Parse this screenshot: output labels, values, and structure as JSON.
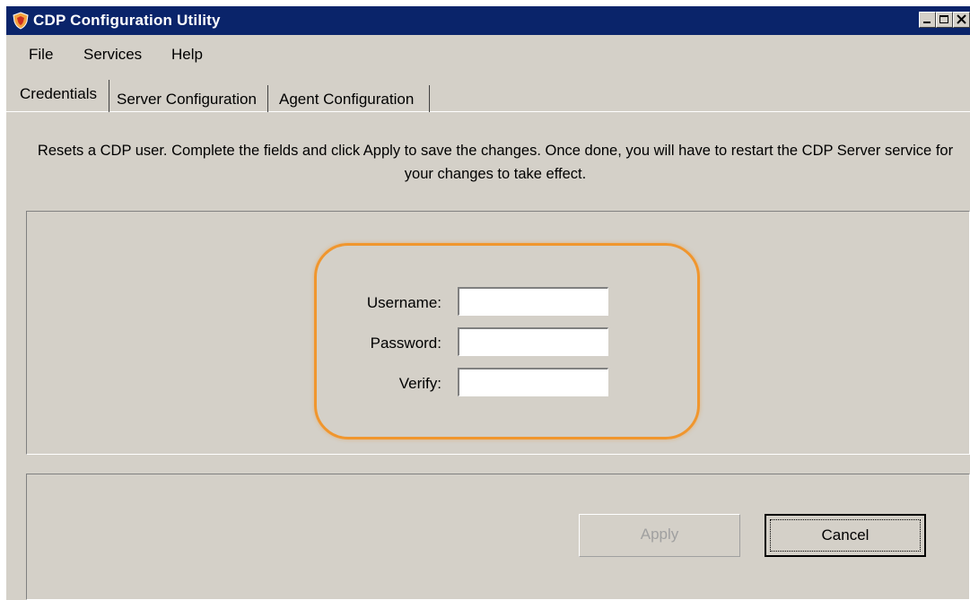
{
  "window": {
    "title": "CDP Configuration Utility",
    "icon": "shield-icon",
    "controls": [
      "minimize-icon",
      "maximize-icon",
      "close-icon"
    ]
  },
  "menu": {
    "items": [
      "File",
      "Services",
      "Help"
    ]
  },
  "tabs": {
    "items": [
      "Credentials",
      "Server Configuration",
      "Agent Configuration"
    ],
    "active": "Credentials"
  },
  "description": "Resets a CDP user. Complete the fields and click Apply to save the changes. Once done, you will have to restart the CDP Server service for your changes to take effect.",
  "form": {
    "username": {
      "label": "Username:",
      "value": ""
    },
    "password": {
      "label": "Password:",
      "value": ""
    },
    "verify": {
      "label": "Verify:",
      "value": ""
    }
  },
  "buttons": {
    "apply": {
      "label": "Apply",
      "enabled": false
    },
    "cancel": {
      "label": "Cancel",
      "enabled": true
    }
  },
  "colors": {
    "titlebar": "#0a246a",
    "highlight": "#f0962e",
    "window_bg": "#d4d0c8"
  }
}
